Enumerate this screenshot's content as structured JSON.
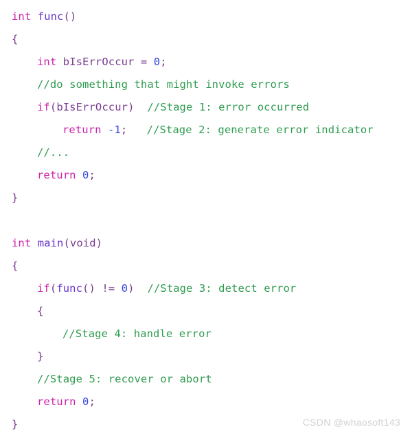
{
  "editor": {
    "language": "C",
    "background_color": "#ffffff",
    "syntax_colors": {
      "keyword": "#cc22aa",
      "function": "#6633cc",
      "identifier": "#7a3b8f",
      "punctuation": "#7a3b8f",
      "number": "#3344dd",
      "comment": "#2e9b4f"
    }
  },
  "code": {
    "lines": [
      {
        "indent": 0,
        "text": "int func()"
      },
      {
        "indent": 0,
        "text": "{"
      },
      {
        "indent": 1,
        "text": "int bIsErrOccur = 0;"
      },
      {
        "indent": 1,
        "text": "//do something that might invoke errors"
      },
      {
        "indent": 1,
        "text": "if(bIsErrOccur)  //Stage 1: error occurred"
      },
      {
        "indent": 2,
        "text": "return -1;   //Stage 2: generate error indicator"
      },
      {
        "indent": 1,
        "text": "//..."
      },
      {
        "indent": 1,
        "text": "return 0;"
      },
      {
        "indent": 0,
        "text": "}"
      },
      {
        "indent": 0,
        "text": ""
      },
      {
        "indent": 0,
        "text": "int main(void)"
      },
      {
        "indent": 0,
        "text": "{"
      },
      {
        "indent": 1,
        "text": "if(func() != 0)  //Stage 3: detect error"
      },
      {
        "indent": 1,
        "text": "{"
      },
      {
        "indent": 2,
        "text": "//Stage 4: handle error"
      },
      {
        "indent": 1,
        "text": "}"
      },
      {
        "indent": 1,
        "text": "//Stage 5: recover or abort"
      },
      {
        "indent": 1,
        "text": "return 0;"
      },
      {
        "indent": 0,
        "text": "}"
      }
    ],
    "line_01": "int func()",
    "line_02": "{",
    "line_03": "int bIsErrOccur = 0;",
    "line_04": "//do something that might invoke errors",
    "line_05_code": "if(bIsErrOccur)",
    "line_05_comment": "//Stage 1: error occurred",
    "line_06_code": "return -1;",
    "line_06_comment": "//Stage 2: generate error indicator",
    "line_07": "//...",
    "line_08": "return 0;",
    "line_09": "}",
    "line_11": "int main(void)",
    "line_12": "{",
    "line_13_code": "if(func() != 0)",
    "line_13_comment": "//Stage 3: detect error",
    "line_14": "{",
    "line_15": "//Stage 4: handle error",
    "line_16": "}",
    "line_17": "//Stage 5: recover or abort",
    "line_18": "return 0;",
    "line_19": "}"
  },
  "tokens": {
    "kw_int": "int",
    "kw_return": "return",
    "kw_if": "if",
    "fn_func": "func",
    "fn_main": "main",
    "id_bIsErrOccur": "bIsErrOccur",
    "id_void": "void",
    "num_zero": "0",
    "num_minus_one": "-1",
    "paren_open": "(",
    "paren_close": ")",
    "paren_empty": "()",
    "brace_open": "{",
    "brace_close": "}",
    "semicolon": ";",
    "assign": "=",
    "not_equal": "!=",
    "space": " "
  },
  "watermark": {
    "text": "CSDN @whaosoft143",
    "color": "#d2d2d2"
  }
}
